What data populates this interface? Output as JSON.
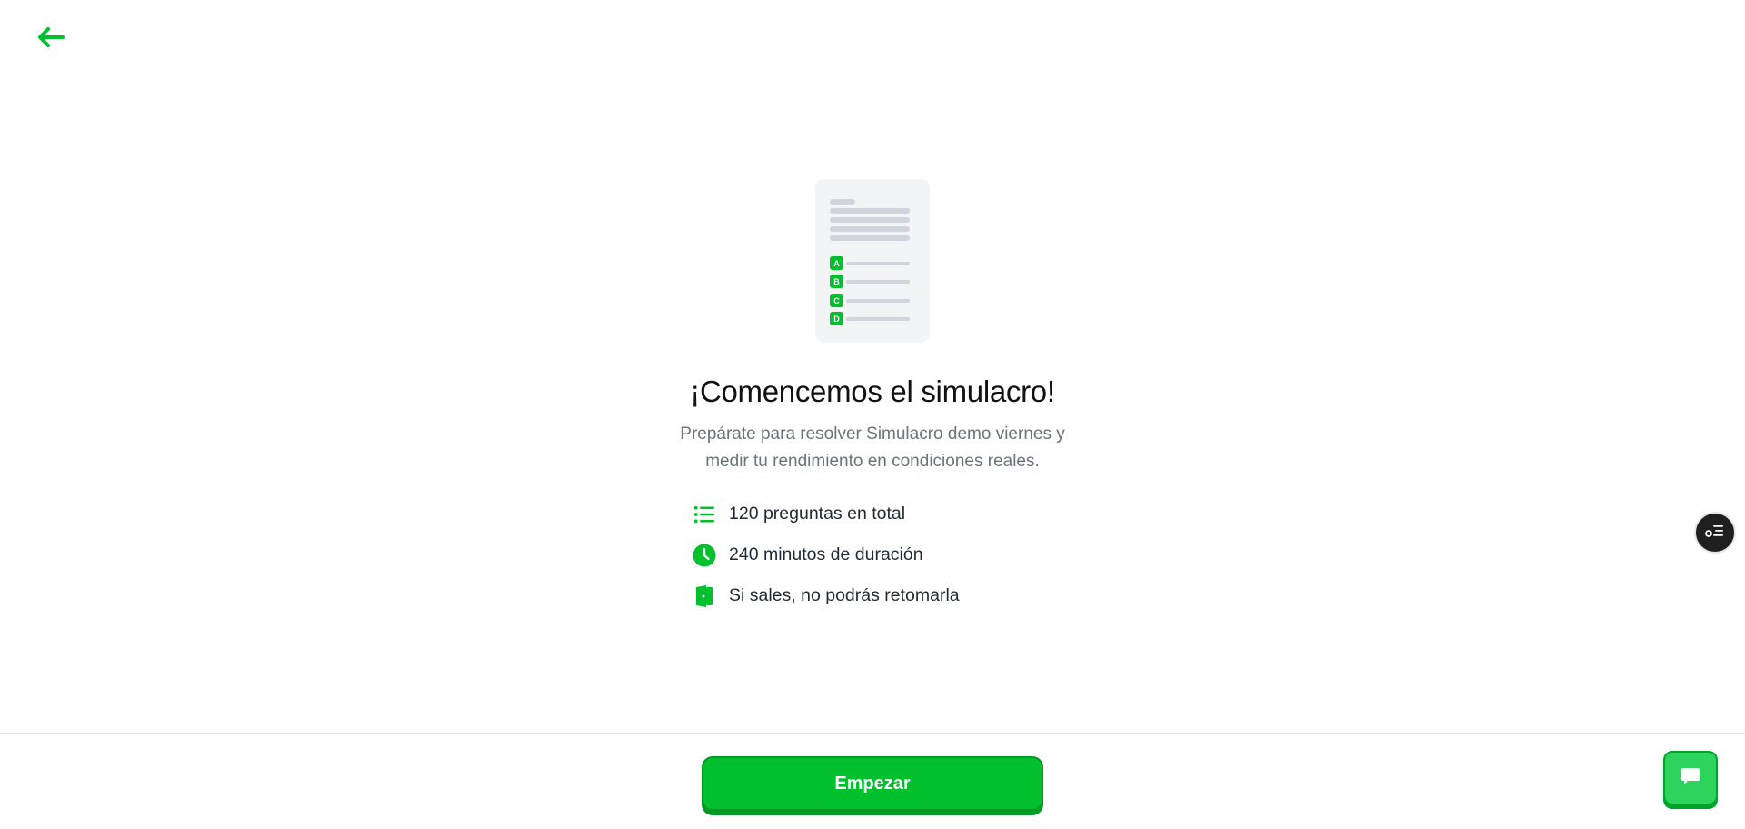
{
  "nav": {
    "back_icon": "arrow-left-icon"
  },
  "illustration": {
    "options": [
      "A",
      "B",
      "C",
      "D"
    ]
  },
  "main": {
    "title": "¡Comencemos el simulacro!",
    "subtitle": "Prepárate para resolver Simulacro demo viernes y medir tu rendimiento en condiciones reales."
  },
  "info": {
    "items": [
      {
        "icon": "list-icon",
        "text": "120 preguntas en total"
      },
      {
        "icon": "clock-icon",
        "text": "240 minutos de duración"
      },
      {
        "icon": "exit-door-icon",
        "text": "Si sales, no podrás retomarla"
      }
    ]
  },
  "footer": {
    "start_label": "Empezar"
  },
  "floating": {
    "side_icon": "question-list-icon",
    "chat_icon": "chat-bubble-icon"
  },
  "colors": {
    "accent": "#00c02d",
    "accent_dark": "#009a24",
    "text": "#111111",
    "muted": "#6b7280"
  }
}
